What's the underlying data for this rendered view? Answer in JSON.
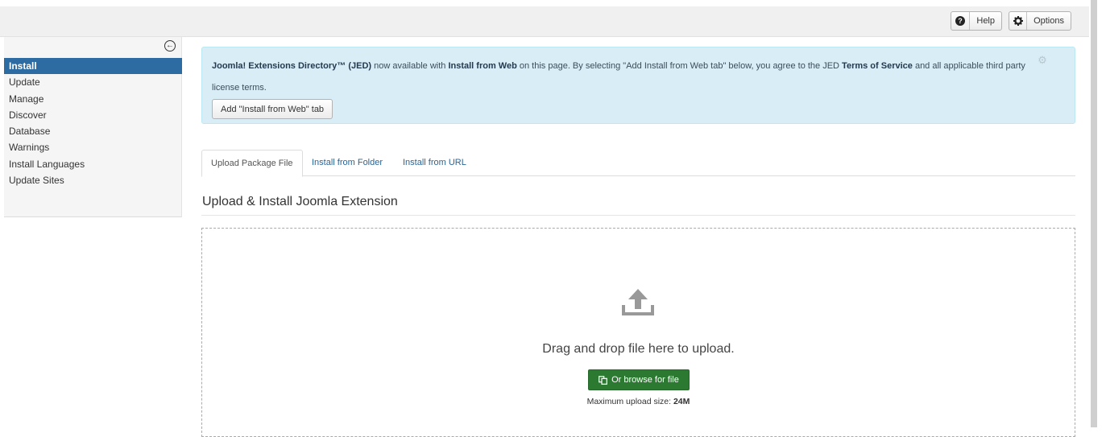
{
  "toolbar": {
    "help_label": "Help",
    "options_label": "Options",
    "help_icon": "question-circle-icon",
    "options_icon": "gear-icon"
  },
  "sidebar": {
    "collapse_icon": "collapse-left-icon",
    "items": [
      {
        "label": "Install",
        "active": true
      },
      {
        "label": "Update"
      },
      {
        "label": "Manage"
      },
      {
        "label": "Discover"
      },
      {
        "label": "Database"
      },
      {
        "label": "Warnings"
      },
      {
        "label": "Install Languages"
      },
      {
        "label": "Update Sites"
      }
    ]
  },
  "alert": {
    "jed_name": "Joomla! Extensions Directory™ (JED)",
    "text_1": " now available with ",
    "install_from_web": "Install from Web",
    "text_2": " on this page. By selecting \"Add Install from Web tab\" below, you agree to the JED ",
    "terms": "Terms of Service",
    "text_3": " and all applicable third party license terms.",
    "button_label": "Add \"Install from Web\" tab",
    "close_icon": "gear-icon"
  },
  "tabs": [
    {
      "label": "Upload Package File",
      "active": true
    },
    {
      "label": "Install from Folder"
    },
    {
      "label": "Install from URL"
    }
  ],
  "main": {
    "title": "Upload & Install Joomla Extension",
    "drop_text": "Drag and drop file here to upload.",
    "browse_label": "Or browse for file",
    "browse_icon": "copy-icon",
    "max_label": "Maximum upload size: ",
    "max_value": "24M",
    "upload_icon": "upload-icon"
  },
  "colors": {
    "active_nav": "#2d6ca2",
    "alert_bg": "#d9edf7",
    "browse_btn": "#2c7a32",
    "link": "#2a6496"
  }
}
